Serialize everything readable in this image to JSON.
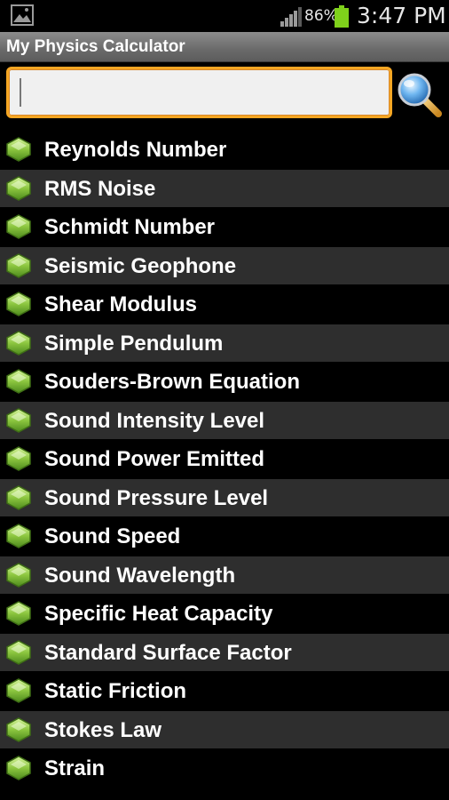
{
  "status_bar": {
    "battery_percent": "86%",
    "clock": "3:47 PM",
    "icons": [
      "gallery-icon",
      "signal-icon",
      "battery-icon"
    ],
    "battery_color": "#7fd11b"
  },
  "app": {
    "title": "My Physics Calculator"
  },
  "search": {
    "value": "",
    "placeholder": "",
    "button_icon": "search-icon",
    "border_color": "#f5a623"
  },
  "list": {
    "item_icon": "green-hexagon-icon",
    "items": [
      {
        "label": "Reynolds Number"
      },
      {
        "label": "RMS Noise"
      },
      {
        "label": "Schmidt Number"
      },
      {
        "label": "Seismic Geophone"
      },
      {
        "label": "Shear Modulus"
      },
      {
        "label": "Simple Pendulum"
      },
      {
        "label": "Souders-Brown Equation"
      },
      {
        "label": "Sound Intensity Level"
      },
      {
        "label": "Sound Power Emitted"
      },
      {
        "label": "Sound Pressure Level"
      },
      {
        "label": "Sound Speed"
      },
      {
        "label": "Sound Wavelength"
      },
      {
        "label": "Specific Heat Capacity"
      },
      {
        "label": "Standard Surface Factor"
      },
      {
        "label": "Static Friction"
      },
      {
        "label": "Stokes Law"
      },
      {
        "label": "Strain"
      }
    ]
  }
}
